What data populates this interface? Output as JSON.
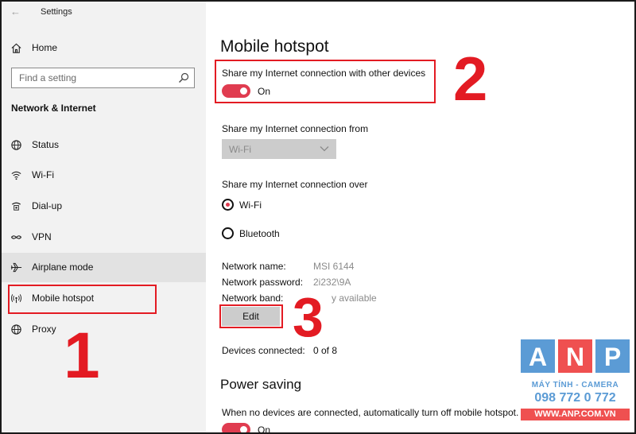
{
  "window": {
    "title": "Settings"
  },
  "sidebar": {
    "home_label": "Home",
    "search_placeholder": "Find a setting",
    "section_title": "Network & Internet",
    "items": [
      {
        "label": "Status",
        "icon": "globe-icon"
      },
      {
        "label": "Wi-Fi",
        "icon": "wifi-icon"
      },
      {
        "label": "Dial-up",
        "icon": "dialup-icon"
      },
      {
        "label": "VPN",
        "icon": "vpn-icon"
      },
      {
        "label": "Airplane mode",
        "icon": "airplane-icon"
      },
      {
        "label": "Mobile hotspot",
        "icon": "hotspot-icon"
      },
      {
        "label": "Proxy",
        "icon": "globe-icon"
      }
    ]
  },
  "main": {
    "title": "Mobile hotspot",
    "share_label": "Share my Internet connection with other devices",
    "share_toggle_state": "On",
    "share_from_label": "Share my Internet connection from",
    "share_from_value": "Wi-Fi",
    "share_over_label": "Share my Internet connection over",
    "share_over_options": [
      {
        "label": "Wi-Fi",
        "selected": true
      },
      {
        "label": "Bluetooth",
        "selected": false
      }
    ],
    "network_name_label": "Network name:",
    "network_name_value": "MSI 6144",
    "network_password_label": "Network password:",
    "network_password_value": "2i232\\9A",
    "network_band_label": "Network band:",
    "network_band_value": "y available",
    "edit_label": "Edit",
    "devices_connected_label": "Devices connected:",
    "devices_connected_value": "0 of 8",
    "power_saving_title": "Power saving",
    "power_saving_desc": "When no devices are connected, automatically turn off mobile hotspot.",
    "power_saving_toggle_state": "On"
  },
  "annotations": {
    "step1": "1",
    "step2": "2",
    "step3": "3"
  },
  "logo": {
    "letters": [
      "A",
      "N",
      "P"
    ],
    "tagline": "MÁY TÍNH - CAMERA",
    "phone": "098 772 0 772",
    "website": "WWW.ANP.COM.VN"
  },
  "colors": {
    "accent": "#e03c50",
    "annotation_red": "#e31b23",
    "sidebar_bg": "#f2f2f2",
    "logo_blue": "#5b9bd5",
    "logo_red": "#ef5050"
  }
}
